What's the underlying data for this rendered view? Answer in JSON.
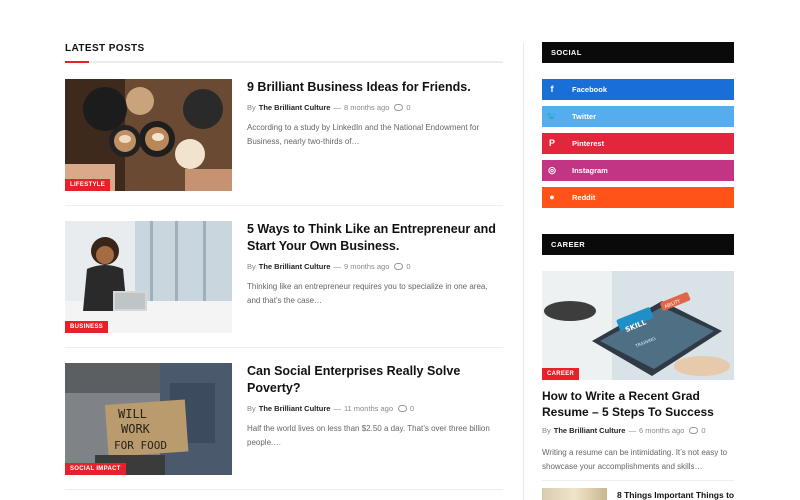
{
  "latest": {
    "heading": "LATEST POSTS",
    "posts": [
      {
        "category": "LIFESTYLE",
        "title": "9 Brilliant Business Ideas for Friends.",
        "by": "By",
        "author": "The Brilliant Culture",
        "dash": "—",
        "date": "8 months ago",
        "comments": "0",
        "excerpt": "According to a study by LinkedIn and the National Endowment for Business, nearly two-thirds of…"
      },
      {
        "category": "BUSINESS",
        "title": "5 Ways to Think Like an Entrepreneur and Start Your Own Business.",
        "by": "By",
        "author": "The Brilliant Culture",
        "dash": "—",
        "date": "9 months ago",
        "comments": "0",
        "excerpt": "Thinking like an entrepreneur requires you to specialize in one area, and that’s the case…"
      },
      {
        "category": "SOCIAL IMPACT",
        "title": "Can Social Enterprises Really Solve Poverty?",
        "by": "By",
        "author": "The Brilliant Culture",
        "dash": "—",
        "date": "11 months ago",
        "comments": "0",
        "excerpt": "Half the world lives on less than $2.50 a day. That’s over three billion people.…",
        "image_sign_text": "WILL WORK FOR FOOD"
      }
    ]
  },
  "sidebar": {
    "social": {
      "heading": "SOCIAL",
      "items": [
        {
          "label": "Facebook",
          "icon": "facebook-icon",
          "glyph": "f",
          "color": "#1a6ed8"
        },
        {
          "label": "Twitter",
          "icon": "twitter-icon",
          "glyph": "🐦",
          "color": "#55acee"
        },
        {
          "label": "Pinterest",
          "icon": "pinterest-icon",
          "glyph": "P",
          "color": "#e3263b"
        },
        {
          "label": "Instagram",
          "icon": "instagram-icon",
          "glyph": "◎",
          "color": "#c13584"
        },
        {
          "label": "Reddit",
          "icon": "reddit-icon",
          "glyph": "●",
          "color": "#ff5317"
        }
      ]
    },
    "career": {
      "heading": "CAREER",
      "category": "CAREER",
      "title": "How to Write a Recent Grad Resume – 5 Steps To Success",
      "by": "By",
      "author": "The Brilliant Culture",
      "dash": "—",
      "date": "6 months ago",
      "comments": "0",
      "excerpt": "Writing a resume can be intimidating. It’s not easy to showcase your accomplishments and skills…",
      "image_words": [
        "SKILL",
        "TRAINING",
        "ABILITY"
      ],
      "next_title": "8 Things Important Things to"
    }
  },
  "colors": {
    "accent": "#e8202a",
    "widget_head": "#0a0a0a"
  }
}
